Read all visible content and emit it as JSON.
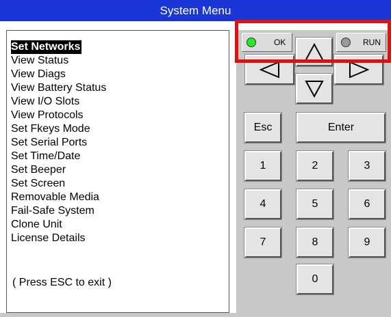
{
  "window": {
    "title": "System Menu"
  },
  "menu": {
    "items": [
      {
        "label": "Set Networks",
        "selected": true
      },
      {
        "label": "View Status",
        "selected": false
      },
      {
        "label": "View Diags",
        "selected": false
      },
      {
        "label": "View Battery Status",
        "selected": false
      },
      {
        "label": "View I/O Slots",
        "selected": false
      },
      {
        "label": "View Protocols",
        "selected": false
      },
      {
        "label": "Set Fkeys Mode",
        "selected": false
      },
      {
        "label": "Set Serial Ports",
        "selected": false
      },
      {
        "label": "Set Time/Date",
        "selected": false
      },
      {
        "label": "Set Beeper",
        "selected": false
      },
      {
        "label": "Set Screen",
        "selected": false
      },
      {
        "label": "Removable Media",
        "selected": false
      },
      {
        "label": "Fail-Safe System",
        "selected": false
      },
      {
        "label": "Clone Unit",
        "selected": false
      },
      {
        "label": "License Details",
        "selected": false
      }
    ],
    "footer": "( Press ESC to exit )"
  },
  "indicators": {
    "ok": {
      "label": "OK",
      "color": "#22ee22"
    },
    "run": {
      "label": "RUN",
      "color": "#9a9a9a"
    }
  },
  "keypad": {
    "up_icon": "arrow-up-icon",
    "down_icon": "arrow-down-icon",
    "left_icon": "arrow-left-icon",
    "right_icon": "arrow-right-icon",
    "esc": "Esc",
    "enter": "Enter",
    "digits": [
      "1",
      "2",
      "3",
      "4",
      "5",
      "6",
      "7",
      "8",
      "9",
      "0"
    ]
  },
  "colors": {
    "title_bar": "#1a36d6",
    "panel": "#c8c8c8",
    "highlight": "#e01010"
  }
}
